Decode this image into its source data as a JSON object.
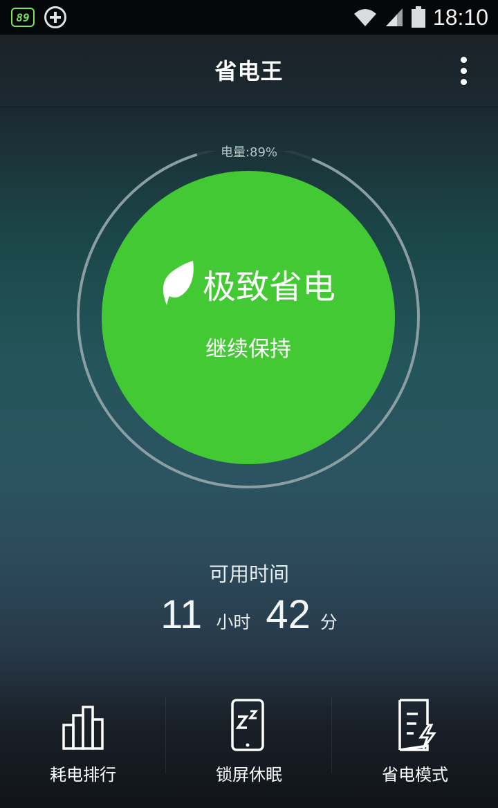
{
  "status_bar": {
    "battery_badge": "89",
    "time": "18:10"
  },
  "header": {
    "title": "省电王"
  },
  "battery": {
    "label": "电量:89%",
    "level_percent": 89
  },
  "mode": {
    "title": "极致省电",
    "subtitle": "继续保持"
  },
  "available_time": {
    "label": "可用时间",
    "hours": "11",
    "hours_unit": "小时",
    "minutes": "42",
    "minutes_unit": "分"
  },
  "bottom_nav": [
    {
      "label": "耗电排行",
      "icon": "bar-chart-icon"
    },
    {
      "label": "锁屏休眠",
      "icon": "sleep-phone-icon"
    },
    {
      "label": "省电模式",
      "icon": "power-mode-icon"
    }
  ],
  "colors": {
    "accent_green": "#43c933",
    "status_badge_green": "#79e15a"
  }
}
